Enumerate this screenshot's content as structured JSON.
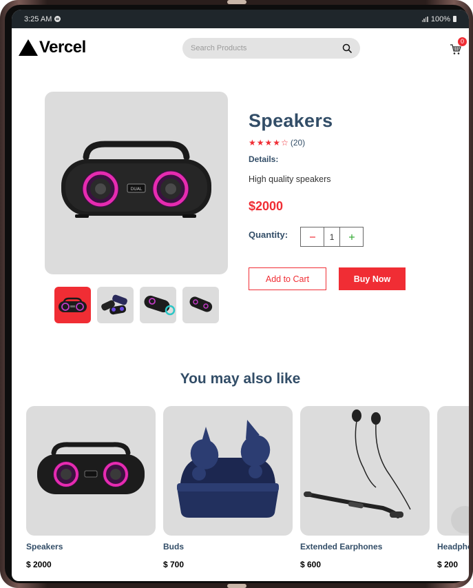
{
  "status_bar": {
    "time": "3:25 AM",
    "battery": "100%",
    "spotify_icon": "spotify-icon",
    "signal_icon": "signal-icon",
    "battery_icon": "battery-icon"
  },
  "navbar": {
    "logo": "Vercel",
    "search_placeholder": "Search Products",
    "search_icon": "search-icon",
    "cart_icon": "cart-icon",
    "cart_count": "0"
  },
  "product": {
    "title": "Speakers",
    "rating_stars": 4,
    "rating_max": 5,
    "rating_count": "(20)",
    "details_label": "Details:",
    "details_text": "High quality speakers",
    "price": "$2000",
    "quantity_label": "Quantity:",
    "quantity": "1",
    "minus_icon": "minus-icon",
    "plus_icon": "plus-icon",
    "add_to_cart": "Add to Cart",
    "buy_now": "Buy Now",
    "thumbnails": [
      "speaker-front",
      "speaker-group",
      "speaker-angled",
      "speaker-side"
    ],
    "selected_thumbnail": 0
  },
  "also_like": {
    "title": "You may also like",
    "items": [
      {
        "name": "Speakers",
        "price": "$ 2000",
        "image": "speaker-image"
      },
      {
        "name": "Buds",
        "price": "$ 700",
        "image": "earbuds-image"
      },
      {
        "name": "Extended Earphones",
        "price": "$ 600",
        "image": "neckband-earphones-image"
      },
      {
        "name": "Headphones",
        "price": "$ 200",
        "image": "headphones-image"
      }
    ]
  },
  "colors": {
    "accent": "#f02d34",
    "heading": "#324d67",
    "card_bg": "#dcdcdc",
    "status_bar": "#1f262b"
  }
}
